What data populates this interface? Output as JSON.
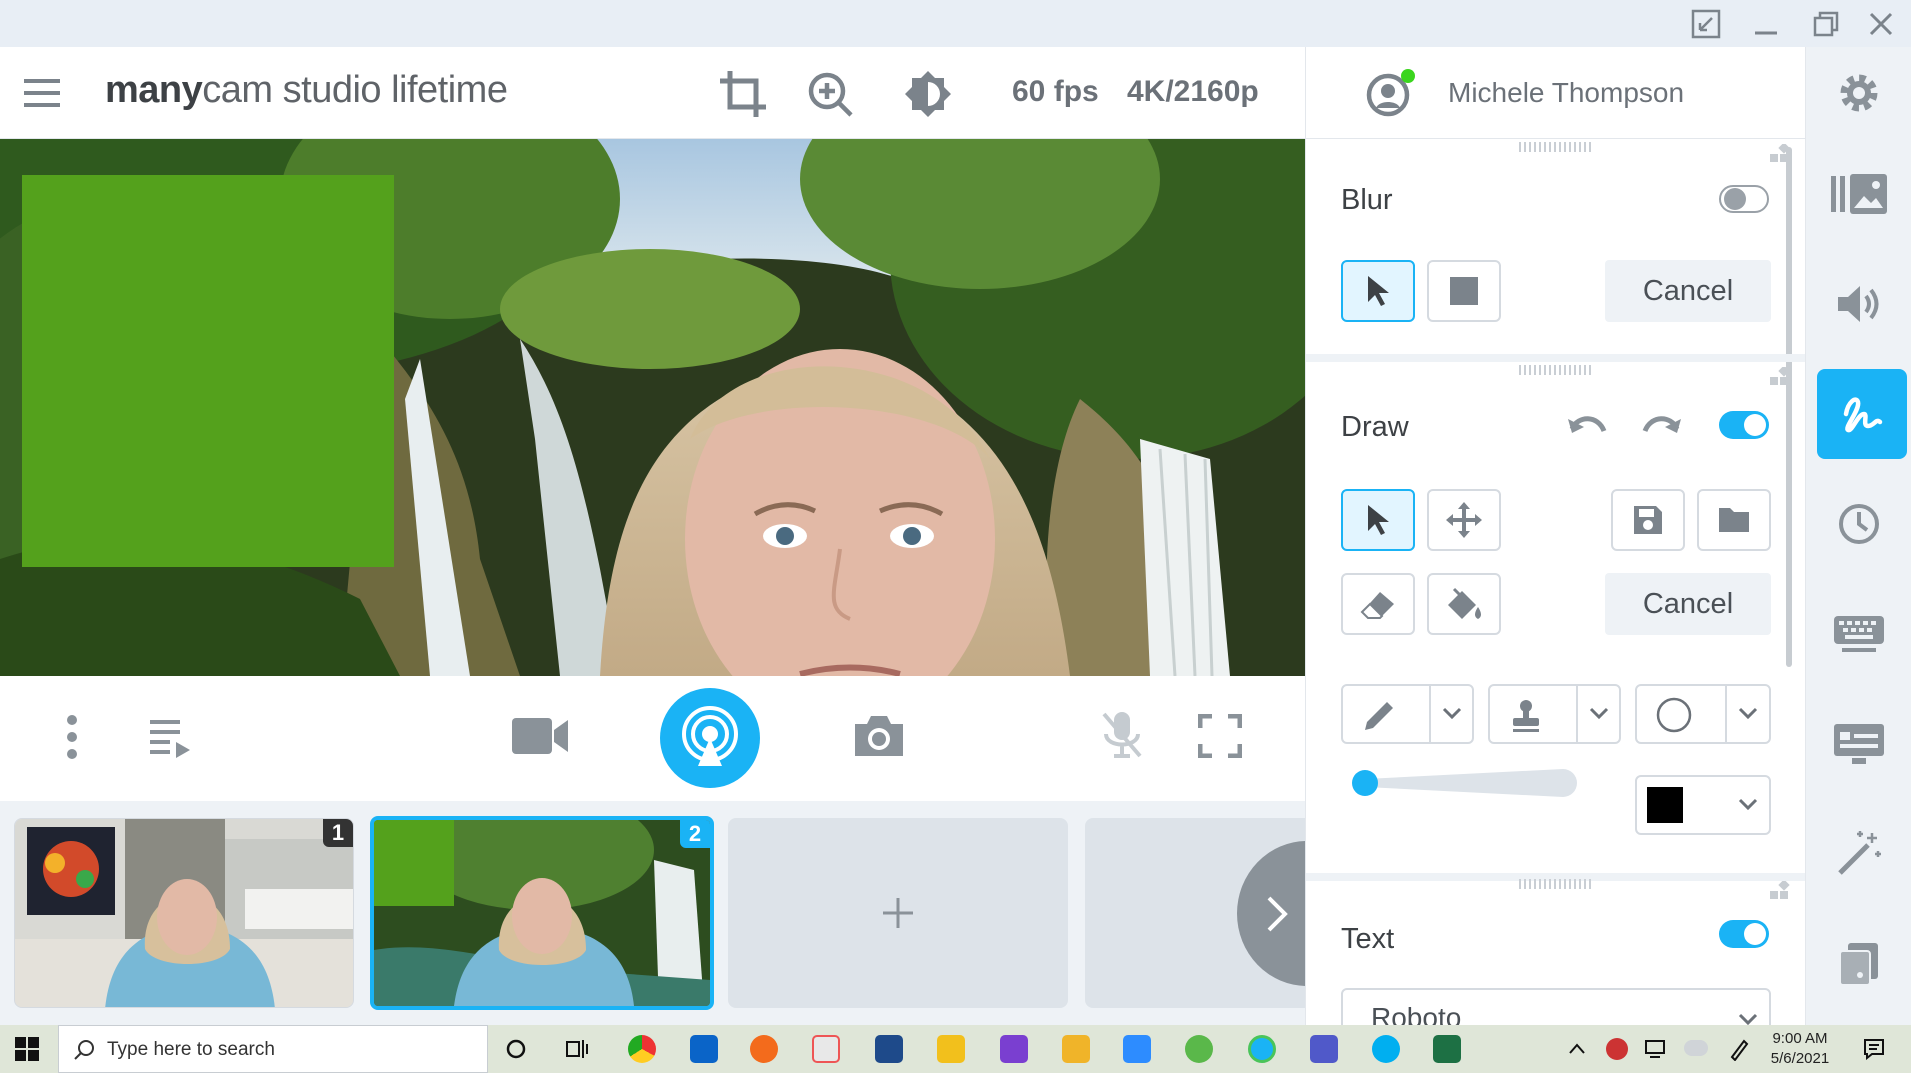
{
  "app": {
    "brand_bold": "many",
    "brand_mid": "cam",
    "brand_rest": " studio lifetime"
  },
  "header": {
    "fps": "60 fps",
    "resolution": "4K/2160p"
  },
  "profile": {
    "user_name": "Michele Thompson",
    "status_color": "#3bd51e"
  },
  "presets": [
    {
      "number": "1"
    },
    {
      "number": "2"
    }
  ],
  "panel": {
    "blur": {
      "title": "Blur",
      "enabled": false,
      "cancel": "Cancel"
    },
    "draw": {
      "title": "Draw",
      "enabled": true,
      "cancel": "Cancel"
    },
    "text": {
      "title": "Text",
      "enabled": true,
      "font": "Roboto"
    }
  },
  "taskbar": {
    "search_placeholder": "Type here to search",
    "time": "9:00 AM",
    "date": "5/6/2021"
  },
  "colors": {
    "accent": "#1ab3f5",
    "green_rect": "#54a11c",
    "draw_color": "#000000"
  }
}
